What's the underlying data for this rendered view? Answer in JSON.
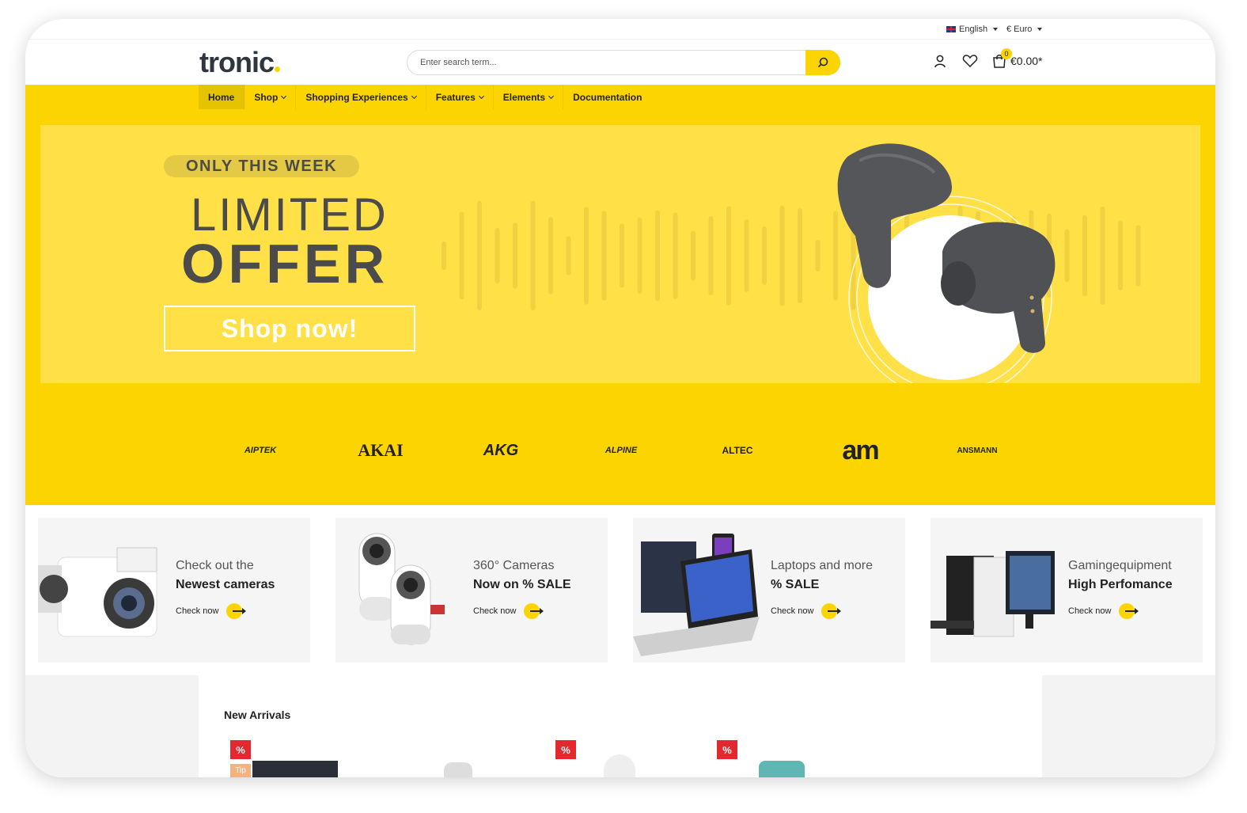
{
  "topbar": {
    "language": "English",
    "currency": "€ Euro"
  },
  "header": {
    "logo": "tronic",
    "search_placeholder": "Enter search term...",
    "cart_count": "0",
    "cart_total": "€0.00*"
  },
  "nav": {
    "items": [
      {
        "label": "Home"
      },
      {
        "label": "Shop"
      },
      {
        "label": "Shopping Experiences"
      },
      {
        "label": "Features"
      },
      {
        "label": "Elements"
      },
      {
        "label": "Documentation"
      }
    ]
  },
  "hero": {
    "tag": "ONLY THIS WEEK",
    "title_line1": "LIMITED",
    "title_line2": "OFFER",
    "button": "Shop now!"
  },
  "brands": [
    "AIPTEK",
    "AKAI",
    "AKG",
    "ALPINE",
    "ALTEC",
    "am",
    "ANSMANN"
  ],
  "categories": [
    {
      "line1": "Check out the",
      "line2": "Newest cameras",
      "cta": "Check now"
    },
    {
      "line1": "360° Cameras",
      "line2": "Now on % SALE",
      "cta": "Check now"
    },
    {
      "line1": "Laptops and more",
      "line2": "% SALE",
      "cta": "Check now"
    },
    {
      "line1": "Gamingequipment",
      "line2": "High Perfomance",
      "cta": "Check now"
    }
  ],
  "arrivals": {
    "title": "New Arrivals",
    "badge": "%",
    "tip": "Tip"
  },
  "colors": {
    "accent": "#fcd500",
    "banner": "#ffe047",
    "text_dark": "#4b4b4b",
    "sale": "#e1292f"
  }
}
